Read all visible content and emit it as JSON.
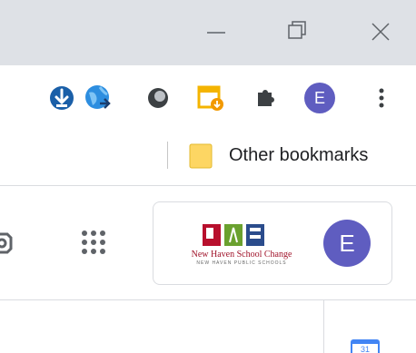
{
  "window_controls": {
    "minimize_icon": "minimize-icon",
    "restore_icon": "restore-icon",
    "close_icon": "close-icon"
  },
  "toolbar": {
    "extensions": [
      "download-extension-icon",
      "globe-extension-icon",
      "circle-extension-icon",
      "calendar-extension-icon",
      "extensions-puzzle-icon"
    ],
    "profile_initial": "E",
    "profile_color": "#5f5dc0",
    "menu_icon": "more-vert-icon"
  },
  "bookmarks_bar": {
    "other_bookmarks_label": "Other bookmarks"
  },
  "page_header": {
    "settings_icon": "gear-icon",
    "apps_icon": "apps-grid-icon",
    "logo": {
      "name": "New Haven School Change",
      "subtitle": "NEW HAVEN PUBLIC SCHOOLS"
    },
    "account_initial": "E",
    "account_color": "#5f5dc0"
  },
  "side_panel": {
    "calendar_icon": "google-calendar-icon",
    "calendar_day": "31"
  }
}
